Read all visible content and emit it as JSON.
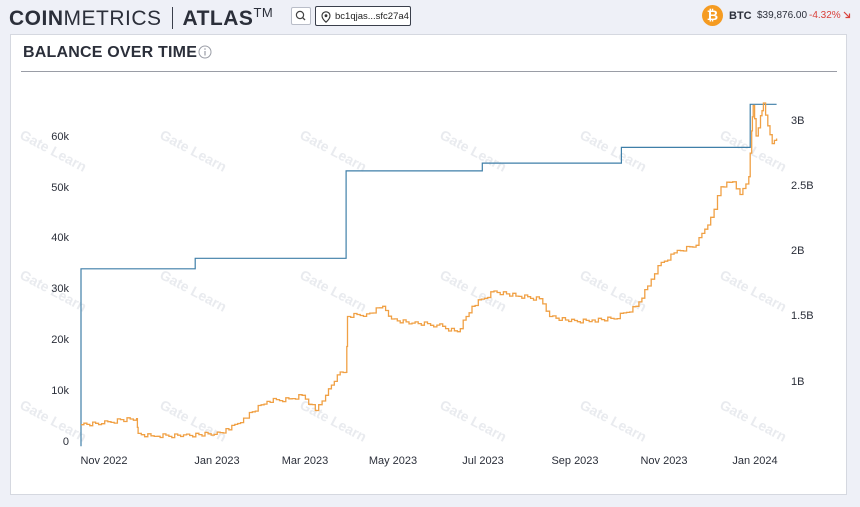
{
  "header": {
    "logo_bold": "COIN",
    "logo_light": "METRICS",
    "product": "ATLAS",
    "trademark": "TM",
    "address": "bc1qjas...sfc27a4"
  },
  "ticker": {
    "symbol": "BTC",
    "price": "$39,876.00",
    "change": "-4.32%",
    "change_icon": "arrow-down-right-icon"
  },
  "colors": {
    "balance_line": "#f0a044",
    "usd_line": "#3f7fa8",
    "btc_badge": "#f59b21",
    "negative": "#d9413b"
  },
  "panel": {
    "title": "BALANCE OVER TIME",
    "watermark": "Gate Learn"
  },
  "chart_data": {
    "type": "line",
    "x_tick_labels": [
      "Nov 2022",
      "Jan 2023",
      "Mar 2023",
      "May 2023",
      "Jul 2023",
      "Sep 2023",
      "Nov 2023",
      "Jan 2024"
    ],
    "x_range": [
      "2022-10-01",
      "2024-01-22"
    ],
    "y_left_ticks": [
      "0",
      "10k",
      "20k",
      "30k",
      "40k",
      "50k",
      "60k"
    ],
    "y_left_range": [
      0,
      60000
    ],
    "y_right_ticks": [
      "1B",
      "1.5B",
      "2B",
      "2.5B",
      "3B"
    ],
    "y_right_range": [
      0.5,
      3.0
    ],
    "y_right_unit": "B",
    "grid": false,
    "series": [
      {
        "axis": "right",
        "shape": "step",
        "points": [
          [
            "2022-10-01",
            0.5
          ],
          [
            "2022-10-01",
            1.86
          ],
          [
            "2022-12-18",
            1.86
          ],
          [
            "2022-12-18",
            1.94
          ],
          [
            "2023-03-31",
            1.94
          ],
          [
            "2023-03-31",
            2.61
          ],
          [
            "2023-07-02",
            2.61
          ],
          [
            "2023-07-02",
            2.67
          ],
          [
            "2023-10-05",
            2.67
          ],
          [
            "2023-10-05",
            2.79
          ],
          [
            "2024-01-01",
            2.79
          ],
          [
            "2024-01-01",
            3.12
          ],
          [
            "2024-01-19",
            3.12
          ]
        ]
      },
      {
        "axis": "left",
        "shape": "line",
        "points": [
          [
            "2022-10-01",
            3200
          ],
          [
            "2022-10-15",
            3400
          ],
          [
            "2022-10-28",
            4200
          ],
          [
            "2022-11-08",
            4400
          ],
          [
            "2022-11-09",
            1500
          ],
          [
            "2022-11-20",
            900
          ],
          [
            "2022-12-10",
            1200
          ],
          [
            "2022-12-31",
            1300
          ],
          [
            "2023-01-10",
            2200
          ],
          [
            "2023-01-20",
            4500
          ],
          [
            "2023-02-05",
            7800
          ],
          [
            "2023-02-20",
            8300
          ],
          [
            "2023-03-01",
            9000
          ],
          [
            "2023-03-10",
            6000
          ],
          [
            "2023-03-17",
            9000
          ],
          [
            "2023-03-25",
            13000
          ],
          [
            "2023-03-31",
            13500
          ],
          [
            "2023-04-01",
            24500
          ],
          [
            "2023-04-14",
            25000
          ],
          [
            "2023-04-25",
            26500
          ],
          [
            "2023-05-01",
            24000
          ],
          [
            "2023-05-15",
            23200
          ],
          [
            "2023-06-01",
            22800
          ],
          [
            "2023-06-15",
            21500
          ],
          [
            "2023-06-25",
            26500
          ],
          [
            "2023-07-10",
            29500
          ],
          [
            "2023-07-25",
            28500
          ],
          [
            "2023-08-10",
            28000
          ],
          [
            "2023-08-17",
            24500
          ],
          [
            "2023-08-30",
            23500
          ],
          [
            "2023-09-15",
            23800
          ],
          [
            "2023-09-30",
            24000
          ],
          [
            "2023-10-15",
            26500
          ],
          [
            "2023-10-23",
            30500
          ],
          [
            "2023-10-30",
            34500
          ],
          [
            "2023-11-10",
            37000
          ],
          [
            "2023-11-25",
            38500
          ],
          [
            "2023-12-05",
            44000
          ],
          [
            "2023-12-12",
            50000
          ],
          [
            "2023-12-20",
            51000
          ],
          [
            "2023-12-25",
            48500
          ],
          [
            "2023-12-31",
            52000
          ],
          [
            "2024-01-02",
            61000
          ],
          [
            "2024-01-03",
            66000
          ],
          [
            "2024-01-05",
            60000
          ],
          [
            "2024-01-08",
            64000
          ],
          [
            "2024-01-10",
            66500
          ],
          [
            "2024-01-13",
            62000
          ],
          [
            "2024-01-16",
            58500
          ],
          [
            "2024-01-19",
            59500
          ]
        ]
      }
    ]
  }
}
